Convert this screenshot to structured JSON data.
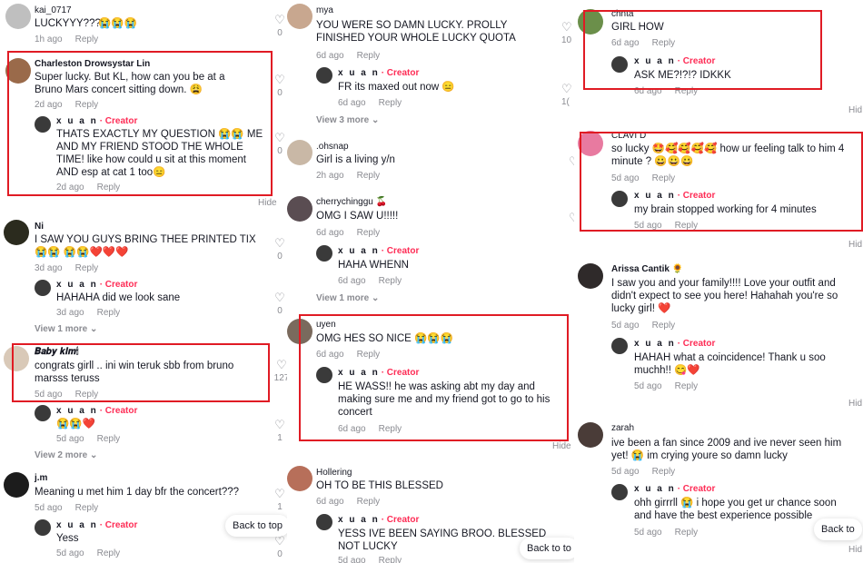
{
  "col1": {
    "comments": [
      {
        "user": "kai_0717",
        "text": "LUCKYYY???",
        "emoji": "😭😭😭",
        "time": "1h ago",
        "reply": "Reply",
        "likes": "0"
      },
      {
        "user": "Charleston Drowsystar Lin",
        "text": "Super lucky. But KL, how can you be at a Bruno Mars concert sitting down. 😩",
        "time": "2d ago",
        "reply": "Reply",
        "likes": "0",
        "creator_reply": {
          "user": "x u a n",
          "badge": "· Creator",
          "text": "THATS EXACTLY MY QUESTION 😭😭 ME AND MY FRIEND STOOD THE WHOLE TIME! like how could u sit at this moment AND esp at cat 1 too😑",
          "time": "2d ago",
          "reply": "Reply",
          "likes": "0"
        }
      },
      {
        "user": "Ni",
        "text": "I SAW YOU GUYS BRING THEE PRINTED TIX 😭😭 😭😭❤️❤️❤️",
        "time": "3d ago",
        "reply": "Reply",
        "likes": "0",
        "creator_reply": {
          "user": "x u a n",
          "badge": "· Creator",
          "text": "HAHAHA did we look sane",
          "time": "3d ago",
          "reply": "Reply",
          "likes": "0"
        }
      },
      {
        "user": "𝑩𝒂𝒃𝒚 𝒌𝒊𝒎🕯",
        "text": "congrats girll .. ini win teruk sbb from bruno marsss teruss",
        "time": "5d ago",
        "reply": "Reply",
        "likes": "127",
        "creator_reply": {
          "user": "x u a n",
          "badge": "· Creator",
          "text": "😭😭❤️",
          "time": "5d ago",
          "reply": "Reply",
          "likes": "1"
        }
      },
      {
        "user": "j.m",
        "text": "Meaning u met him 1 day bfr the concert???",
        "time": "5d ago",
        "reply": "Reply",
        "likes": "1",
        "creator_reply": {
          "user": "x u a n",
          "badge": "· Creator",
          "text": "Yess",
          "time": "5d ago",
          "reply": "Reply",
          "likes": "0"
        }
      }
    ],
    "view_more_1": "View 1 more",
    "view_more_2": "View 2 more",
    "hide": "Hide",
    "back_to_top": "Back to top"
  },
  "col2": {
    "comments": [
      {
        "user": "mya",
        "text": "YOU WERE SO DAMN LUCKY. PROLLY FINISHED YOUR WHOLE LUCKY QUOTA",
        "time": "6d ago",
        "reply": "Reply",
        "likes": "10",
        "creator_reply": {
          "user": "x u a n",
          "badge": "· Creator",
          "text": "FR its maxed out now 😑",
          "time": "6d ago",
          "reply": "Reply",
          "likes": "1("
        }
      },
      {
        "user": ".ohsnap",
        "text": "Girl is a living y/n",
        "time": "2h ago",
        "reply": "Reply"
      },
      {
        "user": "cherrychinggu 🍒",
        "text": "OMG I SAW U!!!!!",
        "time": "6d ago",
        "reply": "Reply",
        "creator_reply": {
          "user": "x u a n",
          "badge": "· Creator",
          "text": "HAHA WHENN",
          "time": "6d ago",
          "reply": "Reply"
        }
      },
      {
        "user": "uyen",
        "text": "OMG HES SO NICE 😭😭😭",
        "time": "6d ago",
        "reply": "Reply",
        "creator_reply": {
          "user": "x u a n",
          "badge": "· Creator",
          "text": "HE WASS!! he was asking abt my day and making sure me and my friend got to go to his concert",
          "time": "6d ago",
          "reply": "Reply"
        }
      },
      {
        "user": "Hollering",
        "text": "OH TO BE THIS BLESSED",
        "time": "6d ago",
        "reply": "Reply",
        "creator_reply": {
          "user": "x u a n",
          "badge": "· Creator",
          "text": "YESS IVE BEEN SAYING BROO. BLESSED NOT LUCKY",
          "time": "5d ago",
          "reply": "Reply"
        }
      }
    ],
    "view_more_3": "View 3 more",
    "view_more_1": "View 1 more",
    "hide": "Hide",
    "back_to_top": "Back to to"
  },
  "col3": {
    "comments": [
      {
        "user": "chnta",
        "text": "GIRL HOW",
        "time": "6d ago",
        "reply": "Reply",
        "creator_reply": {
          "user": "x u a n",
          "badge": "· Creator",
          "text": "ASK ME?!?!? IDKKK",
          "time": "6d ago",
          "reply": "Reply"
        }
      },
      {
        "user": "CLAVI D",
        "text": "so lucky 🤩🥰🥰🥰🥰 how ur feeling talk to him 4 minute ? 😀😀😀",
        "time": "5d ago",
        "reply": "Reply",
        "creator_reply": {
          "user": "x u a n",
          "badge": "· Creator",
          "text": "my brain stopped working for 4 minutes",
          "time": "5d ago",
          "reply": "Reply"
        }
      },
      {
        "user": "Arissa Cantik 🌻",
        "text": "I saw you and your family!!!! Love your outfit and didn't expect to see you here! Hahahah you're so lucky girl! ❤️",
        "time": "5d ago",
        "reply": "Reply",
        "creator_reply": {
          "user": "x u a n",
          "badge": "· Creator",
          "text": "HAHAH what a coincidence! Thank u soo muchh!! 😋❤️",
          "time": "5d ago",
          "reply": "Reply"
        }
      },
      {
        "user": "zarah",
        "text": "ive been a fan since 2009 and ive never seen him yet! 😭 im crying youre so damn lucky",
        "time": "5d ago",
        "reply": "Reply",
        "creator_reply": {
          "user": "x u a n",
          "badge": "· Creator",
          "text": "ohh girrrll 😭 i hope you get ur chance soon and have the best experience possible",
          "time": "5d ago",
          "reply": "Reply"
        }
      }
    ],
    "hide": "Hid",
    "back_to_top": "Back to"
  }
}
